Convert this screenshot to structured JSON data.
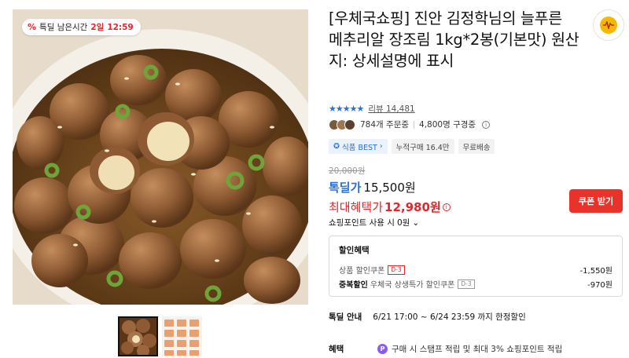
{
  "deal_badge": {
    "icon": "percent-icon",
    "prefix": "특딜 남은시간",
    "days": "2일",
    "time": "12:59"
  },
  "product": {
    "title": "[우체국쇼핑] 진안 김정학님의 늘푸른 메추리알 장조림 1kg*2봉(기본맛) 원산지: 상세설명에 표시",
    "rating_stars": "★★★★★",
    "review_label": "리뷰",
    "review_count": "14,481",
    "order_count": "784개 주문중",
    "subscriber_count": "4,800명 구경중"
  },
  "chips": {
    "best": "식품 BEST",
    "cumulative": "누적구매 16.4만",
    "shipping": "무료배송"
  },
  "price": {
    "original": "20,000원",
    "deal_label": "톡딜가",
    "deal_value": "15,500원",
    "max_label": "최대혜택가",
    "max_value": "12,980원",
    "coupon_button": "쿠폰 받기"
  },
  "points": {
    "label": "쇼핑포인트 사용 시",
    "value": "0원"
  },
  "discount": {
    "heading": "할인혜택",
    "rows": [
      {
        "label": "상품 할인쿠폰",
        "tag": "D-3",
        "amount": "-1,550원"
      },
      {
        "prefix": "중복할인",
        "label": "우체국 상생특가 할인쿠폰",
        "tag": "D-3",
        "amount": "-970원"
      }
    ]
  },
  "deal_guide": {
    "label": "톡딜 안내",
    "period": "6/21 17:00 ~ 6/24 23:59 까지 한정할인"
  },
  "benefit": {
    "label": "혜택",
    "icon": "point-p-icon",
    "text": "구매 시 스탬프 적립 및 최대 3% 쇼핑포인트 적립"
  },
  "colors": {
    "accent_blue": "#2a6fdb",
    "accent_red": "#e4252b",
    "coupon_bg": "#e8322a",
    "fav_yellow": "#f5b800"
  }
}
